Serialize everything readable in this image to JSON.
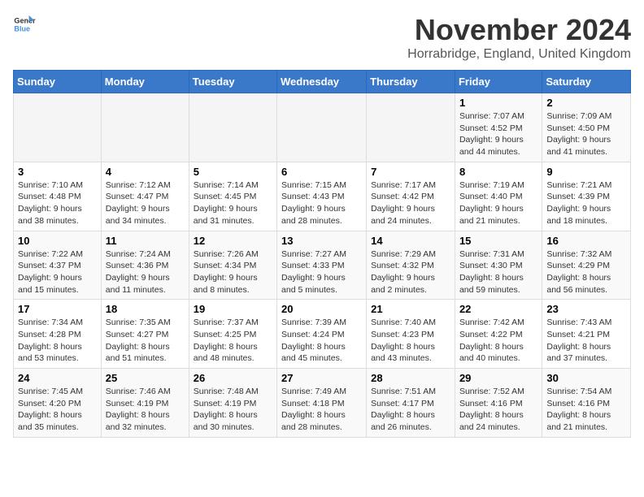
{
  "logo": {
    "text_general": "General",
    "text_blue": "Blue"
  },
  "title": "November 2024",
  "subtitle": "Horrabridge, England, United Kingdom",
  "headers": [
    "Sunday",
    "Monday",
    "Tuesday",
    "Wednesday",
    "Thursday",
    "Friday",
    "Saturday"
  ],
  "weeks": [
    [
      {
        "day": "",
        "info": ""
      },
      {
        "day": "",
        "info": ""
      },
      {
        "day": "",
        "info": ""
      },
      {
        "day": "",
        "info": ""
      },
      {
        "day": "",
        "info": ""
      },
      {
        "day": "1",
        "info": "Sunrise: 7:07 AM\nSunset: 4:52 PM\nDaylight: 9 hours and 44 minutes."
      },
      {
        "day": "2",
        "info": "Sunrise: 7:09 AM\nSunset: 4:50 PM\nDaylight: 9 hours and 41 minutes."
      }
    ],
    [
      {
        "day": "3",
        "info": "Sunrise: 7:10 AM\nSunset: 4:48 PM\nDaylight: 9 hours and 38 minutes."
      },
      {
        "day": "4",
        "info": "Sunrise: 7:12 AM\nSunset: 4:47 PM\nDaylight: 9 hours and 34 minutes."
      },
      {
        "day": "5",
        "info": "Sunrise: 7:14 AM\nSunset: 4:45 PM\nDaylight: 9 hours and 31 minutes."
      },
      {
        "day": "6",
        "info": "Sunrise: 7:15 AM\nSunset: 4:43 PM\nDaylight: 9 hours and 28 minutes."
      },
      {
        "day": "7",
        "info": "Sunrise: 7:17 AM\nSunset: 4:42 PM\nDaylight: 9 hours and 24 minutes."
      },
      {
        "day": "8",
        "info": "Sunrise: 7:19 AM\nSunset: 4:40 PM\nDaylight: 9 hours and 21 minutes."
      },
      {
        "day": "9",
        "info": "Sunrise: 7:21 AM\nSunset: 4:39 PM\nDaylight: 9 hours and 18 minutes."
      }
    ],
    [
      {
        "day": "10",
        "info": "Sunrise: 7:22 AM\nSunset: 4:37 PM\nDaylight: 9 hours and 15 minutes."
      },
      {
        "day": "11",
        "info": "Sunrise: 7:24 AM\nSunset: 4:36 PM\nDaylight: 9 hours and 11 minutes."
      },
      {
        "day": "12",
        "info": "Sunrise: 7:26 AM\nSunset: 4:34 PM\nDaylight: 9 hours and 8 minutes."
      },
      {
        "day": "13",
        "info": "Sunrise: 7:27 AM\nSunset: 4:33 PM\nDaylight: 9 hours and 5 minutes."
      },
      {
        "day": "14",
        "info": "Sunrise: 7:29 AM\nSunset: 4:32 PM\nDaylight: 9 hours and 2 minutes."
      },
      {
        "day": "15",
        "info": "Sunrise: 7:31 AM\nSunset: 4:30 PM\nDaylight: 8 hours and 59 minutes."
      },
      {
        "day": "16",
        "info": "Sunrise: 7:32 AM\nSunset: 4:29 PM\nDaylight: 8 hours and 56 minutes."
      }
    ],
    [
      {
        "day": "17",
        "info": "Sunrise: 7:34 AM\nSunset: 4:28 PM\nDaylight: 8 hours and 53 minutes."
      },
      {
        "day": "18",
        "info": "Sunrise: 7:35 AM\nSunset: 4:27 PM\nDaylight: 8 hours and 51 minutes."
      },
      {
        "day": "19",
        "info": "Sunrise: 7:37 AM\nSunset: 4:25 PM\nDaylight: 8 hours and 48 minutes."
      },
      {
        "day": "20",
        "info": "Sunrise: 7:39 AM\nSunset: 4:24 PM\nDaylight: 8 hours and 45 minutes."
      },
      {
        "day": "21",
        "info": "Sunrise: 7:40 AM\nSunset: 4:23 PM\nDaylight: 8 hours and 43 minutes."
      },
      {
        "day": "22",
        "info": "Sunrise: 7:42 AM\nSunset: 4:22 PM\nDaylight: 8 hours and 40 minutes."
      },
      {
        "day": "23",
        "info": "Sunrise: 7:43 AM\nSunset: 4:21 PM\nDaylight: 8 hours and 37 minutes."
      }
    ],
    [
      {
        "day": "24",
        "info": "Sunrise: 7:45 AM\nSunset: 4:20 PM\nDaylight: 8 hours and 35 minutes."
      },
      {
        "day": "25",
        "info": "Sunrise: 7:46 AM\nSunset: 4:19 PM\nDaylight: 8 hours and 32 minutes."
      },
      {
        "day": "26",
        "info": "Sunrise: 7:48 AM\nSunset: 4:19 PM\nDaylight: 8 hours and 30 minutes."
      },
      {
        "day": "27",
        "info": "Sunrise: 7:49 AM\nSunset: 4:18 PM\nDaylight: 8 hours and 28 minutes."
      },
      {
        "day": "28",
        "info": "Sunrise: 7:51 AM\nSunset: 4:17 PM\nDaylight: 8 hours and 26 minutes."
      },
      {
        "day": "29",
        "info": "Sunrise: 7:52 AM\nSunset: 4:16 PM\nDaylight: 8 hours and 24 minutes."
      },
      {
        "day": "30",
        "info": "Sunrise: 7:54 AM\nSunset: 4:16 PM\nDaylight: 8 hours and 21 minutes."
      }
    ]
  ]
}
